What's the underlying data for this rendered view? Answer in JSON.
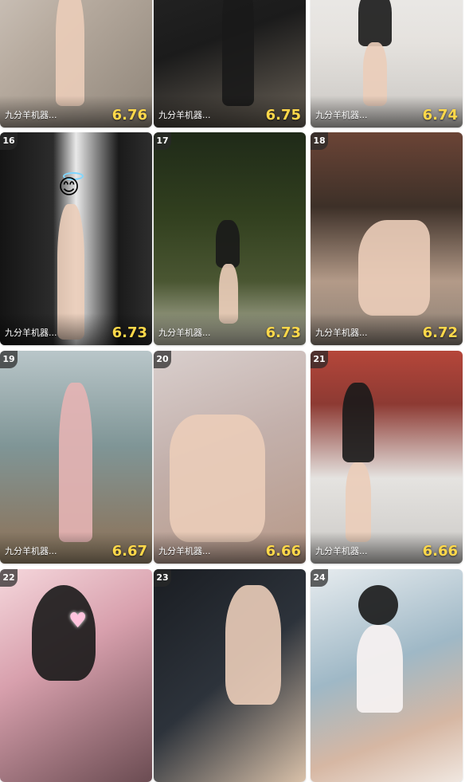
{
  "cards": [
    {
      "rank": "",
      "name": "九分羊机器...",
      "score": "6.76"
    },
    {
      "rank": "",
      "name": "九分羊机器...",
      "score": "6.75"
    },
    {
      "rank": "",
      "name": "九分羊机器...",
      "score": "6.74"
    },
    {
      "rank": "16",
      "name": "九分羊机器...",
      "score": "6.73"
    },
    {
      "rank": "17",
      "name": "九分羊机器...",
      "score": "6.73"
    },
    {
      "rank": "18",
      "name": "九分羊机器...",
      "score": "6.72"
    },
    {
      "rank": "19",
      "name": "九分羊机器...",
      "score": "6.67"
    },
    {
      "rank": "20",
      "name": "九分羊机器...",
      "score": "6.66"
    },
    {
      "rank": "21",
      "name": "九分羊机器...",
      "score": "6.66"
    },
    {
      "rank": "22",
      "name": "",
      "score": ""
    },
    {
      "rank": "23",
      "name": "",
      "score": ""
    },
    {
      "rank": "24",
      "name": "",
      "score": ""
    }
  ],
  "colors": {
    "score": "#ffd84a",
    "rank_bg": "#282828"
  },
  "icons": {
    "card16": "angel-emoji-icon",
    "card22": "heart-sticker-icon"
  }
}
